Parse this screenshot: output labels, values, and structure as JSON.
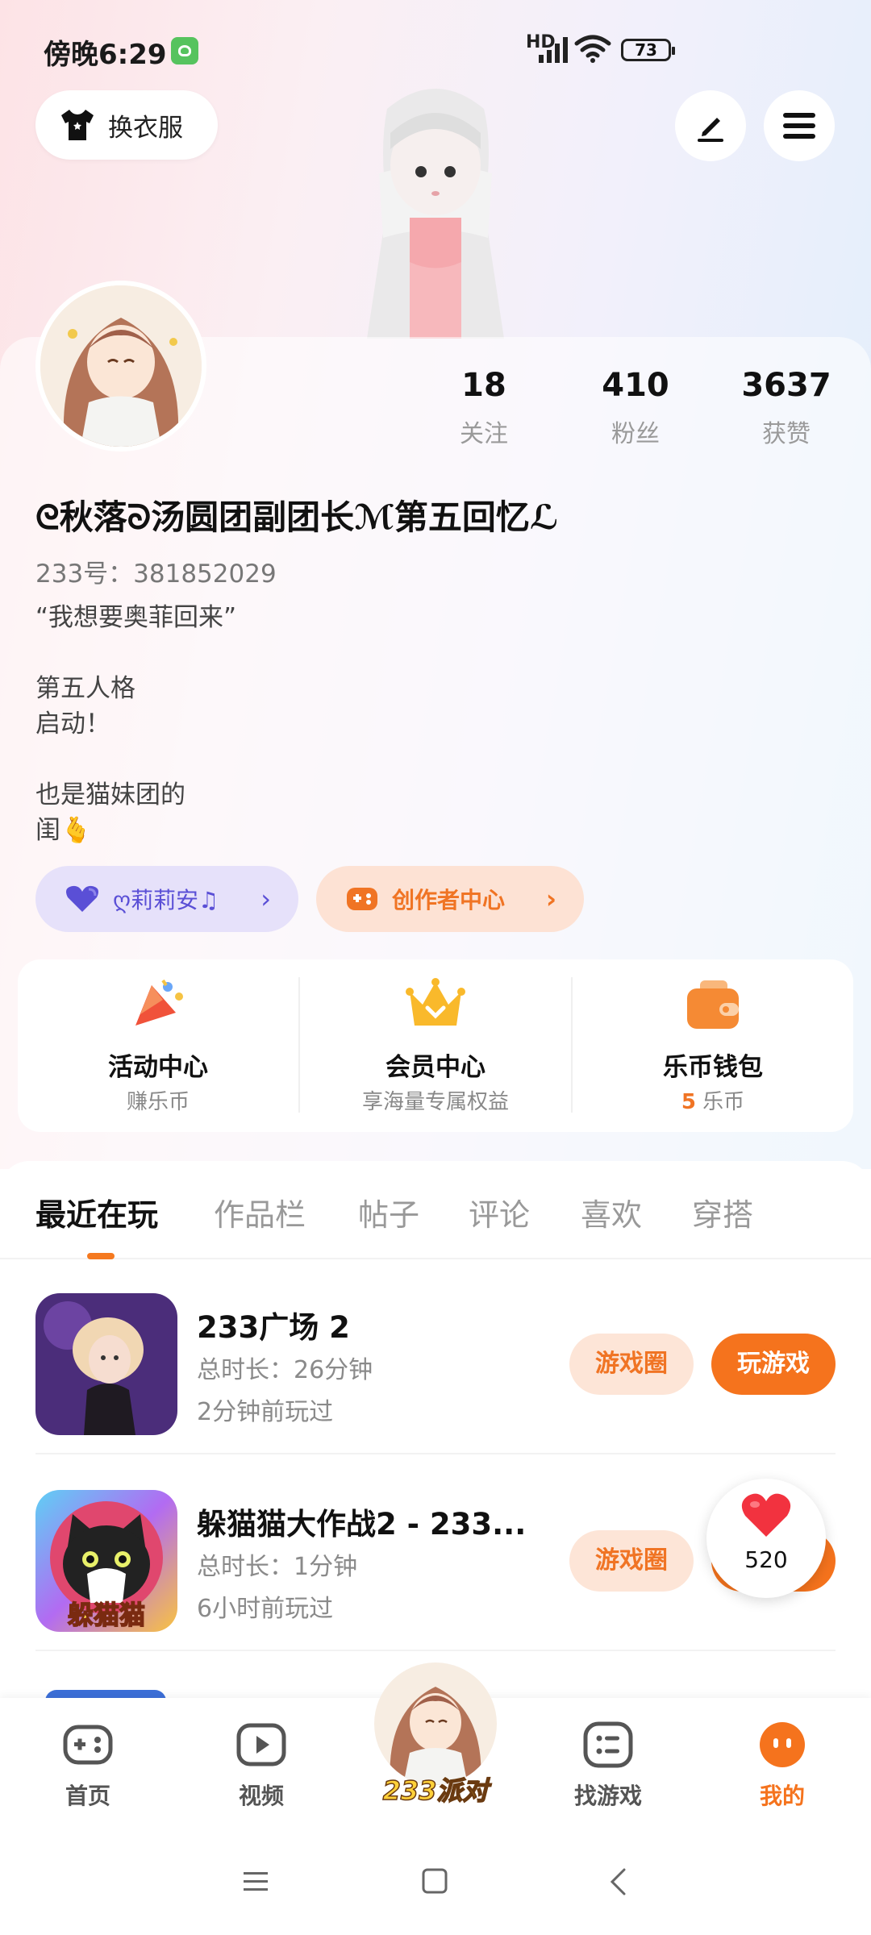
{
  "status_bar": {
    "time": "傍晚6:29",
    "network": "HD",
    "battery": "73"
  },
  "header": {
    "dress_up_label": "换衣服"
  },
  "profile": {
    "stats": [
      {
        "value": "18",
        "label": "关注"
      },
      {
        "value": "410",
        "label": "粉丝"
      },
      {
        "value": "3637",
        "label": "获赞"
      }
    ],
    "nickname": "ᘓ秋落ᘐ汤圆团副团长ℳ第五回忆ℒ",
    "uid": "233号：381852029",
    "bio": "“我想要奥菲回来”\n\n第五人格\n启动！\n\n也是猫妹团的\n闺🫰",
    "music_pill": "ღ莉莉安♫",
    "creator_pill": "创作者中心"
  },
  "services": [
    {
      "title": "活动中心",
      "subtitle": "赚乐币"
    },
    {
      "title": "会员中心",
      "subtitle": "享海量专属权益"
    },
    {
      "title": "乐币钱包",
      "coin_amount": "5",
      "subtitle": "乐币"
    }
  ],
  "tabs": [
    "最近在玩",
    "作品栏",
    "帖子",
    "评论",
    "喜欢",
    "穿搭"
  ],
  "games": [
    {
      "name": "233广场 2",
      "duration": "总时长：26分钟",
      "last_played": "2分钟前玩过",
      "circle_label": "游戏圈",
      "play_label": "玩游戏"
    },
    {
      "name": "躲猫猫大作战2 - 233...",
      "duration": "总时长：1分钟",
      "last_played": "6小时前玩过",
      "circle_label": "游戏圈",
      "icon_text": "躲猫猫"
    }
  ],
  "like_bubble": {
    "count": "520"
  },
  "bottom_nav": [
    {
      "label": "首页"
    },
    {
      "label": "视频"
    },
    {
      "label": "233派对"
    },
    {
      "label": "找游戏"
    },
    {
      "label": "我的"
    }
  ],
  "colors": {
    "accent": "#f5731d",
    "accent_light": "#fde5d7",
    "music_purple": "#5a4fd6"
  }
}
